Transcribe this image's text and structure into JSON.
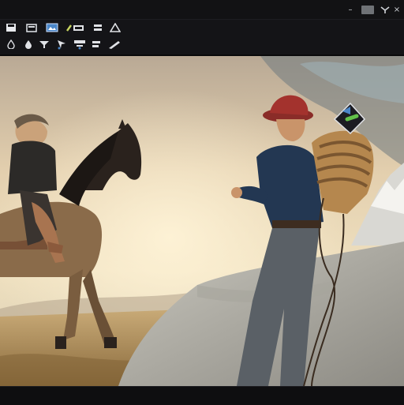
{
  "window": {
    "minimize_glyph": "–",
    "pin_glyph": "★",
    "close_glyph": "×"
  },
  "toolbar": {
    "row1_icons": [
      "save-icon",
      "folder-icon",
      "image-icon",
      "brush-icon",
      "layers-icon",
      "triangle-icon"
    ],
    "row2_icons": [
      "drop-icon",
      "fill-icon",
      "filter-icon",
      "select-icon",
      "crop-icon",
      "pen-icon"
    ],
    "accent": "#4a86c8"
  },
  "canvas": {
    "subject": "artwork",
    "sky_top": "#e6d3b6",
    "ground": "#a78552"
  }
}
